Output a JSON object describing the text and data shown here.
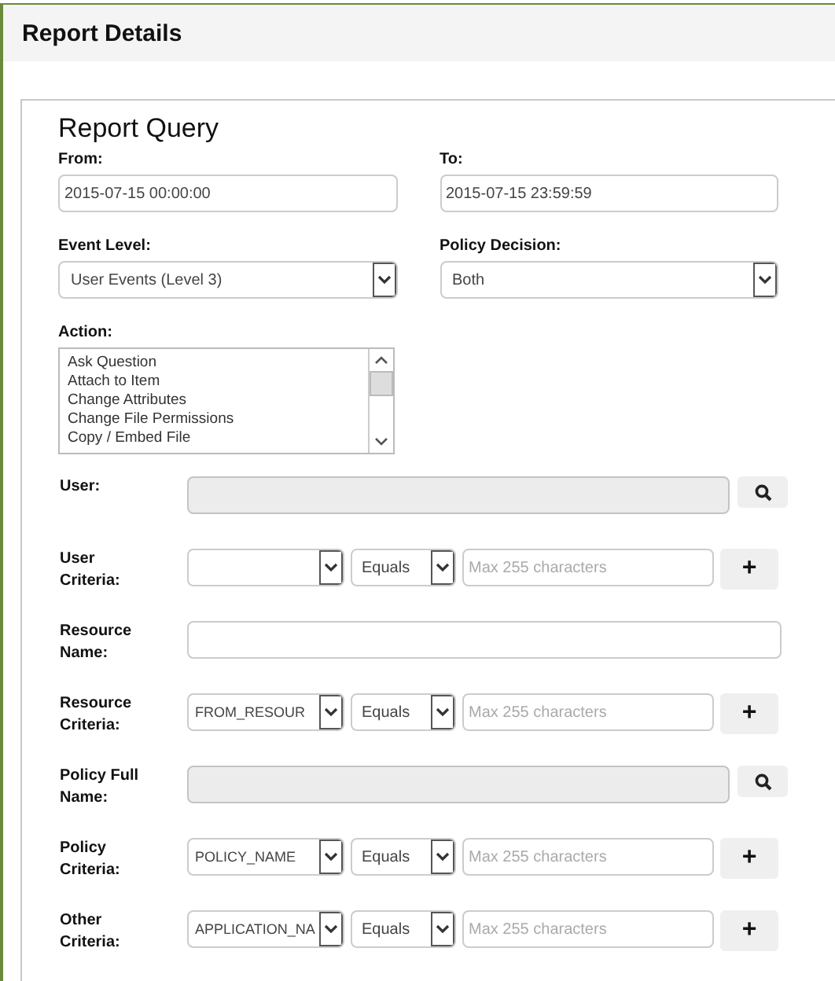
{
  "header": {
    "title": "Report Details"
  },
  "panel": {
    "title": "Report Query"
  },
  "range": [
    {
      "label": "From:",
      "value": "2015-07-15 00:00:00"
    },
    {
      "label": "To:",
      "value": "2015-07-15 23:59:59"
    }
  ],
  "selects": [
    {
      "label": "Event Level:",
      "value": "User Events (Level 3)"
    },
    {
      "label": "Policy Decision:",
      "value": "Both"
    }
  ],
  "action": {
    "label": "Action:",
    "options": [
      "Ask Question",
      "Attach to Item",
      "Change Attributes",
      "Change File Permissions",
      "Copy / Embed File"
    ]
  },
  "rows": [
    {
      "kind": "lookup",
      "label": "User:",
      "disabled": true
    },
    {
      "kind": "criteria",
      "label": "User Criteria:",
      "field": "",
      "operator": "Equals",
      "placeholder": "Max 255 characters",
      "button": "+"
    },
    {
      "kind": "text",
      "label": "Resource Name:"
    },
    {
      "kind": "criteria",
      "label": "Resource Criteria:",
      "field": "FROM_RESOUR",
      "operator": "Equals",
      "placeholder": "Max 255 characters",
      "button": "+"
    },
    {
      "kind": "lookup",
      "label": "Policy Full Name:",
      "disabled": true
    },
    {
      "kind": "criteria",
      "label": "Policy Criteria:",
      "field": "POLICY_NAME",
      "operator": "Equals",
      "placeholder": "Max 255 characters",
      "button": "+"
    },
    {
      "kind": "criteria",
      "label": "Other Criteria:",
      "field": "APPLICATION_NA",
      "operator": "Equals",
      "placeholder": "Max 255 characters",
      "button": "+"
    }
  ]
}
